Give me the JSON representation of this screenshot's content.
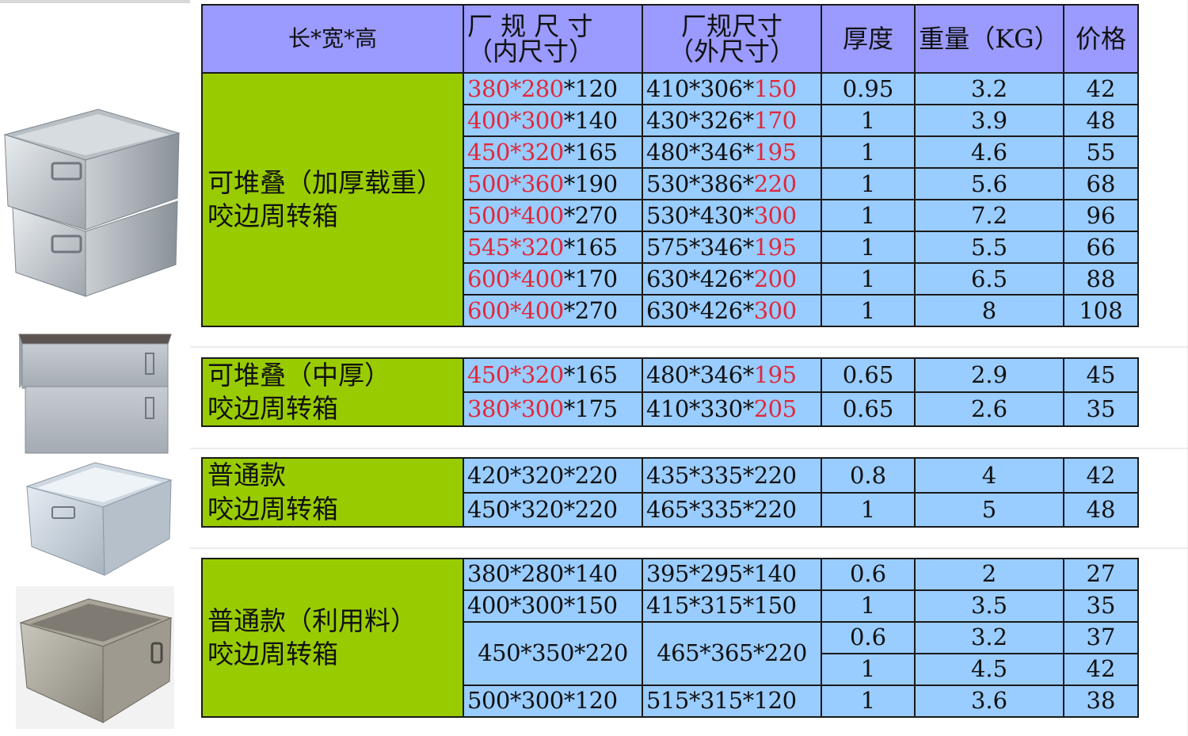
{
  "headers": {
    "col_spec": "长*宽*高",
    "col_inner_line1": "厂 规 尺 寸",
    "col_inner_line2": "（内尺寸）",
    "col_outer_line1": "厂规尺寸",
    "col_outer_line2": "（外尺寸）",
    "col_thickness": "厚度",
    "col_weight": "重量（KG）",
    "col_price": "价格"
  },
  "groups": [
    {
      "name_line1": "可堆叠（加厚载重）",
      "name_line2": "咬边周转箱",
      "rows": [
        {
          "inner_red": "380*280",
          "inner_black": "*120",
          "outer_black": "410*306*",
          "outer_red": "150",
          "thickness": "0.95",
          "weight": "3.2",
          "price": "42"
        },
        {
          "inner_red": "400*300",
          "inner_black": "*140",
          "outer_black": "430*326*",
          "outer_red": "170",
          "thickness": "1",
          "weight": "3.9",
          "price": "48"
        },
        {
          "inner_red": "450*320",
          "inner_black": "*165",
          "outer_black": "480*346*",
          "outer_red": "195",
          "thickness": "1",
          "weight": "4.6",
          "price": "55"
        },
        {
          "inner_red": "500*360",
          "inner_black": "*190",
          "outer_black": "530*386*",
          "outer_red": "220",
          "thickness": "1",
          "weight": "5.6",
          "price": "68"
        },
        {
          "inner_red": "500*400",
          "inner_black": "*270",
          "outer_black": "530*430*",
          "outer_red": "300",
          "thickness": "1",
          "weight": "7.2",
          "price": "96"
        },
        {
          "inner_red": "545*320",
          "inner_black": "*165",
          "outer_black": "575*346*",
          "outer_red": "195",
          "thickness": "1",
          "weight": "5.5",
          "price": "66"
        },
        {
          "inner_red": "600*400",
          "inner_black": "*170",
          "outer_black": "630*426*",
          "outer_red": "200",
          "thickness": "1",
          "weight": "6.5",
          "price": "88"
        },
        {
          "inner_red": "600*400",
          "inner_black": "*270",
          "outer_black": "630*426*",
          "outer_red": "300",
          "thickness": "1",
          "weight": "8",
          "price": "108"
        }
      ]
    },
    {
      "name_line1": "可堆叠（中厚）",
      "name_line2": "咬边周转箱",
      "rows": [
        {
          "inner_red": "450*320",
          "inner_black": "*165",
          "outer_black": "480*346*",
          "outer_red": "195",
          "thickness": "0.65",
          "weight": "2.9",
          "price": "45"
        },
        {
          "inner_red": "380*300",
          "inner_black": "*175",
          "outer_black": "410*330*",
          "outer_red": "205",
          "thickness": "0.65",
          "weight": "2.6",
          "price": "35"
        }
      ]
    },
    {
      "name_line1": "普通款",
      "name_line2": "咬边周转箱",
      "rows": [
        {
          "inner": "420*320*220",
          "outer": "435*335*220",
          "thickness": "0.8",
          "weight": "4",
          "price": "42"
        },
        {
          "inner": "450*320*220",
          "outer": "465*335*220",
          "thickness": "1",
          "weight": "5",
          "price": "48"
        }
      ]
    },
    {
      "name_line1": "普通款（利用料）",
      "name_line2": "咬边周转箱",
      "rows": [
        {
          "inner": "380*280*140",
          "outer": "395*295*140",
          "thickness": "0.6",
          "weight": "2",
          "price": "27"
        },
        {
          "inner": "400*300*150",
          "outer": "415*315*150",
          "thickness": "1",
          "weight": "3.5",
          "price": "35"
        },
        {
          "inner": "450*350*220",
          "outer": "465*365*220",
          "thickness": "0.6",
          "weight": "3.2",
          "price": "37"
        },
        {
          "thickness": "1",
          "weight": "4.5",
          "price": "42"
        },
        {
          "inner": "500*300*120",
          "outer": "515*315*120",
          "thickness": "1",
          "weight": "3.6",
          "price": "38"
        }
      ]
    }
  ],
  "photos": [
    "stacked-thick-galvanized-box-icon",
    "stacked-medium-galvanized-box-icon",
    "standard-galvanized-box-icon",
    "recycled-material-galvanized-box-icon"
  ]
}
